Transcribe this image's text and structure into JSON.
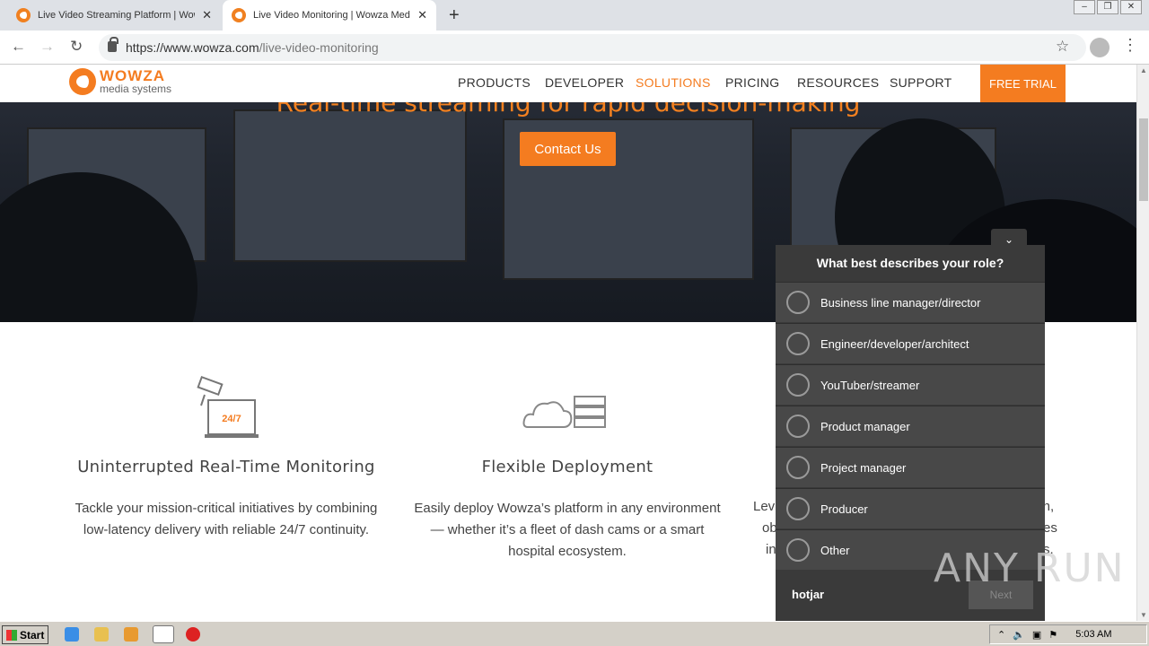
{
  "browser": {
    "tabs": [
      {
        "title": "Live Video Streaming Platform | Wow"
      },
      {
        "title": "Live Video Monitoring | Wowza Medi"
      }
    ],
    "new_tab": "+",
    "url_host": "https://www.wowza.com",
    "url_path": "/live-video-monitoring"
  },
  "header": {
    "logo_name": "WOWZA",
    "logo_sub": "media systems",
    "menu": [
      "PRODUCTS",
      "DEVELOPER",
      "SOLUTIONS",
      "PRICING",
      "RESOURCES",
      "SUPPORT"
    ],
    "active": "SOLUTIONS",
    "free_trial": "FREE TRIAL"
  },
  "hero": {
    "title": "Real-time streaming for rapid decision-making",
    "contact": "Contact Us"
  },
  "features": [
    {
      "title": "Uninterrupted Real-Time Monitoring",
      "text": "Tackle your mission-critical initiatives by combining low-latency delivery with reliable 24/7 continuity.",
      "icon_text": "24/7"
    },
    {
      "title": "Flexible Deployment",
      "text": "Easily deploy Wowza’s platform in any environment — whether it’s a fleet of dash cams or a smart hospital ecosystem."
    },
    {
      "text_frag1": "Lev",
      "text_frag2": "ion,",
      "text_frag3": "ob",
      "text_frag4": "es",
      "text_frag5": "in",
      "text_frag6": "s."
    }
  ],
  "survey": {
    "question": "What best describes your role?",
    "options": [
      "Business line manager/director",
      "Engineer/developer/architect",
      "YouTuber/streamer",
      "Product manager",
      "Project manager",
      "Producer",
      "Other"
    ],
    "brand": "hotjar",
    "next": "Next"
  },
  "watermark": "ANY RUN",
  "taskbar": {
    "start": "Start",
    "clock": "5:03 AM"
  },
  "colors": {
    "accent": "#f47c20",
    "survey_bg": "#3a3a3a"
  }
}
